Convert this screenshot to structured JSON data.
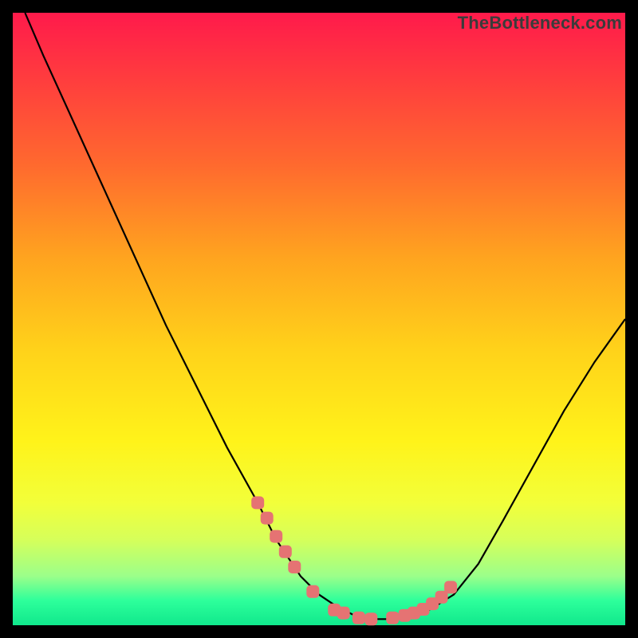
{
  "watermark": "TheBottleneck.com",
  "colors": {
    "frame": "#000000",
    "curve": "#000000",
    "marker": "#e57373",
    "gradient_top": "#ff1a4b",
    "gradient_bottom": "#10e88c"
  },
  "chart_data": {
    "type": "line",
    "title": "",
    "xlabel": "",
    "ylabel": "",
    "xlim": [
      0,
      100
    ],
    "ylim": [
      0,
      100
    ],
    "grid": false,
    "legend": false,
    "series": [
      {
        "name": "bottleneck-curve",
        "x": [
          2,
          5,
          10,
          15,
          20,
          25,
          30,
          35,
          40,
          43,
          47,
          50,
          53,
          56,
          59,
          62,
          65,
          68,
          72,
          76,
          80,
          85,
          90,
          95,
          100
        ],
        "values": [
          100,
          93,
          82,
          71,
          60,
          49,
          39,
          29,
          20,
          14,
          8,
          5,
          3,
          1.5,
          1,
          1,
          1.5,
          2.5,
          5,
          10,
          17,
          26,
          35,
          43,
          50
        ]
      }
    ],
    "markers": {
      "name": "highlight-dots",
      "x": [
        40,
        41.5,
        43,
        44.5,
        46,
        49,
        52.5,
        54,
        56.5,
        58.5,
        62,
        64,
        65.5,
        67,
        68.5,
        70,
        71.5
      ],
      "values": [
        20,
        17.5,
        14.5,
        12,
        9.5,
        5.5,
        2.5,
        2,
        1.2,
        1,
        1.2,
        1.6,
        2,
        2.6,
        3.5,
        4.6,
        6.2
      ]
    }
  }
}
